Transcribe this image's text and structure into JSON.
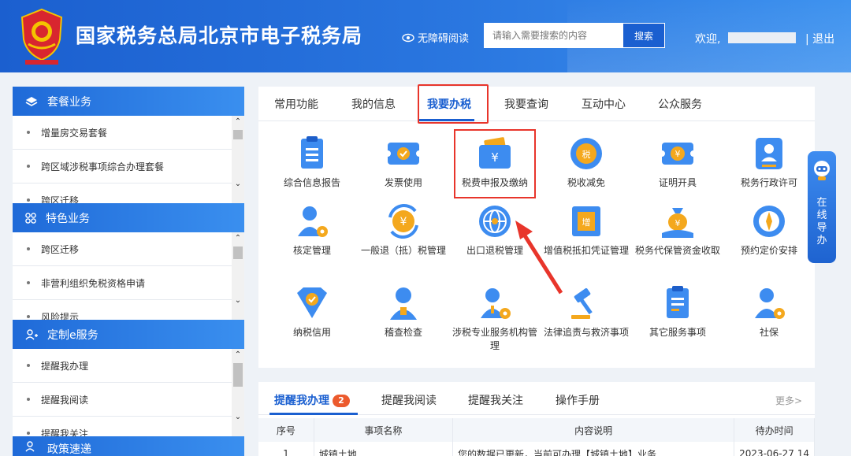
{
  "header": {
    "site_title": "国家税务总局北京市电子税务局",
    "accessibility_label": "无障碍阅读",
    "search_placeholder": "请输入需要搜索的内容",
    "search_button": "搜索",
    "welcome": "欢迎,",
    "logout": "| 退出"
  },
  "sidebar": {
    "sections": [
      {
        "title": "套餐业务",
        "items": [
          "增量房交易套餐",
          "跨区域涉税事项综合办理套餐",
          "跨区迁移"
        ]
      },
      {
        "title": "特色业务",
        "items": [
          "跨区迁移",
          "非营利组织免税资格申请",
          "风险提示"
        ]
      },
      {
        "title": "定制e服务",
        "items": [
          "提醒我办理",
          "提醒我阅读",
          "提醒我关注"
        ]
      },
      {
        "title": "政策速递",
        "items": []
      }
    ]
  },
  "main": {
    "tabs": [
      "常用功能",
      "我的信息",
      "我要办税",
      "我要查询",
      "互动中心",
      "公众服务"
    ],
    "active_tab": "我要办税",
    "items": [
      {
        "label": "综合信息报告",
        "icon": "report-icon"
      },
      {
        "label": "发票使用",
        "icon": "invoice-icon"
      },
      {
        "label": "税费申报及缴纳",
        "icon": "wallet-icon"
      },
      {
        "label": "税收减免",
        "icon": "tax-reduction-icon"
      },
      {
        "label": "证明开具",
        "icon": "certificate-icon"
      },
      {
        "label": "税务行政许可",
        "icon": "permit-icon"
      },
      {
        "label": "核定管理",
        "icon": "user-gear-icon"
      },
      {
        "label": "一般退（抵）税管理",
        "icon": "refund-icon"
      },
      {
        "label": "出口退税管理",
        "icon": "globe-icon"
      },
      {
        "label": "增值税抵扣凭证管理",
        "icon": "vat-icon"
      },
      {
        "label": "税务代保管资金收取",
        "icon": "money-bag-icon"
      },
      {
        "label": "预约定价安排",
        "icon": "compass-icon"
      },
      {
        "label": "纳税信用",
        "icon": "credit-icon"
      },
      {
        "label": "稽查检查",
        "icon": "inspector-icon"
      },
      {
        "label": "涉税专业服务机构管理",
        "icon": "agency-icon"
      },
      {
        "label": "法律追责与救济事项",
        "icon": "gavel-icon"
      },
      {
        "label": "其它服务事项",
        "icon": "list-icon"
      },
      {
        "label": "社保",
        "icon": "social-security-icon"
      }
    ]
  },
  "guide": {
    "label": "在线导办"
  },
  "bottom": {
    "tabs": [
      "提醒我办理",
      "提醒我阅读",
      "提醒我关注",
      "操作手册"
    ],
    "badge": "2",
    "more": "更多>",
    "columns": [
      "序号",
      "事项名称",
      "内容说明",
      "待办时间"
    ],
    "rows": [
      [
        "1",
        "城镇土地...",
        "您的数据已更新，当前可办理【城镇土地】业务",
        "2023-06-27 14"
      ]
    ]
  },
  "colors": {
    "primary": "#1a5fd0",
    "highlight": "#e8352b",
    "badge": "#ec5a2d"
  }
}
